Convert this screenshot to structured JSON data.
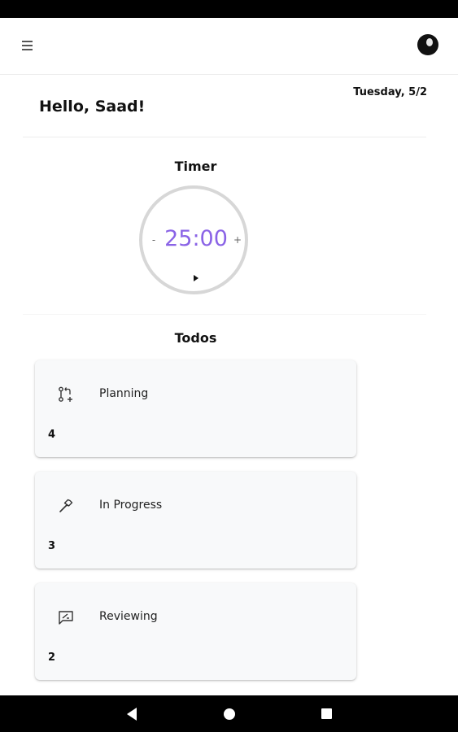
{
  "header": {
    "menu_icon": "hamburger-menu-icon",
    "avatar_icon": "user-avatar-icon"
  },
  "greeting": "Hello, Saad!",
  "date": "Tuesday, 5/2",
  "timer": {
    "title": "Timer",
    "value": "25:00",
    "decrement_label": "-",
    "increment_label": "+",
    "play_icon": "play-icon",
    "accent_color": "#8a63e6"
  },
  "todos": {
    "title": "Todos",
    "items": [
      {
        "label": "Planning",
        "count": "4",
        "icon": "git-pull-request-icon"
      },
      {
        "label": "In Progress",
        "count": "3",
        "icon": "hammer-icon"
      },
      {
        "label": "Reviewing",
        "count": "2",
        "icon": "review-chat-icon"
      }
    ]
  },
  "system_nav": {
    "back_icon": "back-triangle-icon",
    "home_icon": "home-circle-icon",
    "recents_icon": "recents-square-icon"
  }
}
